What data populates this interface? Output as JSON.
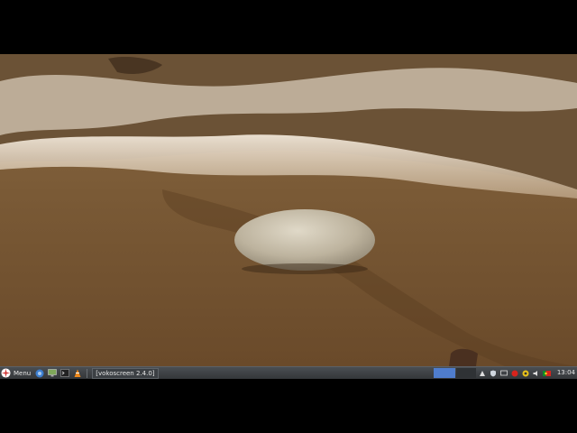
{
  "taskbar": {
    "menu_label": "Menu",
    "window_title": "[vokoscreen 2.4.0]",
    "clock": "13:04"
  },
  "icons": {
    "menu": "rosette-logo-icon",
    "launcher_1": "browser-globe-icon",
    "launcher_2": "monitor-icon",
    "launcher_3": "terminal-icon",
    "launcher_4": "vlc-cone-icon",
    "tray": [
      "network-icon",
      "shield-icon",
      "display-icon",
      "record-icon",
      "notification-icon",
      "volume-icon",
      "flag-icon"
    ]
  },
  "colors": {
    "accent_workspace": "#4f7dcd",
    "record": "#d8231c"
  }
}
